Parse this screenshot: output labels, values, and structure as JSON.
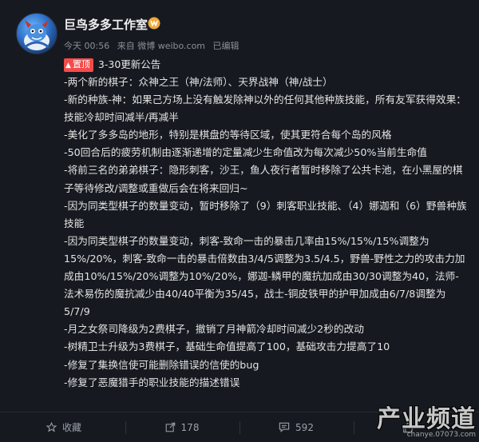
{
  "post": {
    "username": "巨鸟多多工作室",
    "meta": {
      "time": "今天 00:56",
      "source": "来自 微博 weibo.com",
      "edited": "已编辑"
    },
    "pin": {
      "badge": "置顶",
      "title": "3-30更新公告"
    },
    "lines": [
      "-两个新的棋子：众神之王（神/法师）、天界战神（神/战士）",
      "-新的种族-神：如果己方场上没有触发除神以外的任何其他种族技能，所有友军获得效果：技能冷却时间减半/再减半",
      "-美化了多多岛的地形，特别是棋盘的等待区域，使其更符合每个岛的风格",
      "-50回合后的疲劳机制由逐渐递增的定量减少生命值改为每次减少50%当前生命值",
      "-将前三名的弟弟棋子：隐形刺客，沙王，鱼人夜行者暂时移除了公共卡池，在小黑屋的棋子等待修改/调整或重做后会在将来回归~",
      "-因为同类型棋子的数量变动，暂时移除了（9）刺客职业技能、（4）娜迦和（6）野兽种族技能",
      "-因为同类型棋子的数量变动，刺客-致命一击的暴击几率由15%/15%/15%调整为15%/20%，刺客-致命一击的暴击倍数由3/4/5调整为3.5/4.5，野兽-野性之力的攻击力加成由10%/15%/20%调整为10%/20%，娜迦-鳞甲的魔抗加成由30/30调整为40，法师-法术易伤的魔抗减少由40/40平衡为35/45，战士-铜皮铁甲的护甲加成由6/7/8调整为5/7/9",
      "-月之女祭司降级为2费棋子，撤销了月神箭冷却时间减少2秒的改动",
      "-树精卫士升级为3费棋子，基础生命值提高了100，基础攻击力提高了10",
      "-修复了集换信使可能删除错误的信使的bug",
      "-修复了恶魔猎手的职业技能的描述错误"
    ]
  },
  "actions": {
    "favorite": "收藏",
    "share": "178",
    "comment": "592",
    "like": ""
  },
  "watermark": {
    "title": "产业频道",
    "url": "chanye.07073.com"
  },
  "colors": {
    "background": "#161a20",
    "pin_badge": "#f54b4b",
    "meta_text": "#8a8f96"
  }
}
